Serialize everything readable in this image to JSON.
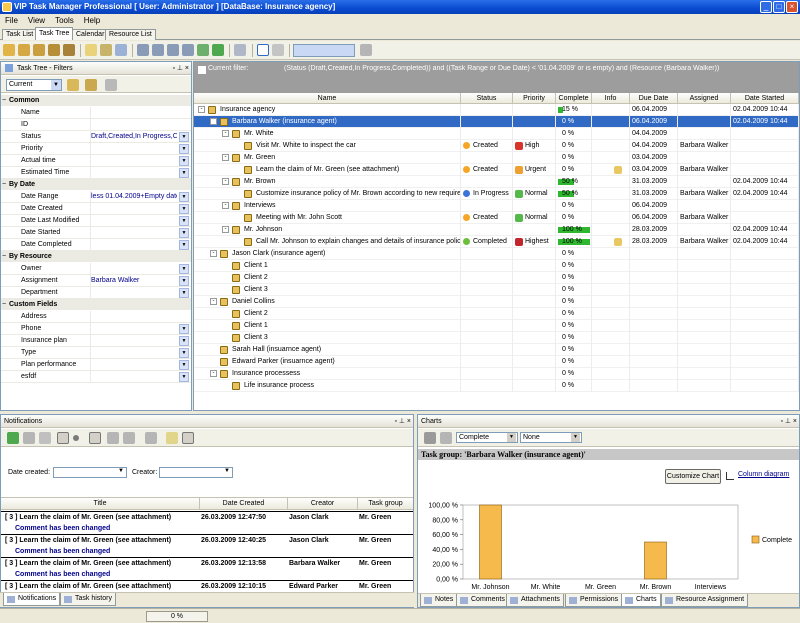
{
  "window": {
    "title": "VIP Task Manager Professional [ User: Administrator ] [DataBase: Insurance agency]"
  },
  "menu": [
    "File",
    "View",
    "Tools",
    "Help"
  ],
  "tabs": [
    "Task List",
    "Task Tree",
    "Calendar",
    "Resource List"
  ],
  "filter_panel": {
    "title": "Task Tree - Filters",
    "current": "Current",
    "categories": [
      {
        "name": "Common",
        "rows": [
          {
            "label": "Name",
            "value": ""
          },
          {
            "label": "ID",
            "value": ""
          },
          {
            "label": "Status",
            "value": "Draft,Created,In Progress,Cor",
            "dd": true
          },
          {
            "label": "Priority",
            "value": "",
            "dd": true
          },
          {
            "label": "Actual time",
            "value": "",
            "dd": true
          },
          {
            "label": "Estimated Time",
            "value": "",
            "dd": true
          }
        ]
      },
      {
        "name": "By Date",
        "rows": [
          {
            "label": "Date Range",
            "value": "less 01.04.2009+Empty date",
            "dd": true
          },
          {
            "label": "Date Created",
            "value": "",
            "dd": true
          },
          {
            "label": "Date Last Modified",
            "value": "",
            "dd": true
          },
          {
            "label": "Date Started",
            "value": "",
            "dd": true
          },
          {
            "label": "Date Completed",
            "value": "",
            "dd": true
          }
        ]
      },
      {
        "name": "By Resource",
        "rows": [
          {
            "label": "Owner",
            "value": "",
            "dd": true
          },
          {
            "label": "Assignment",
            "value": "Barbara Walker",
            "dd": true
          },
          {
            "label": "Department",
            "value": "",
            "dd": true
          }
        ]
      },
      {
        "name": "Custom Fields",
        "rows": [
          {
            "label": "Address",
            "value": ""
          },
          {
            "label": "Phone",
            "value": "",
            "dd": true
          },
          {
            "label": "Insurance plan",
            "value": "",
            "dd": true
          },
          {
            "label": "Type",
            "value": "",
            "dd": true
          },
          {
            "label": "Plan performance",
            "value": "",
            "dd": true
          },
          {
            "label": "esfdf",
            "value": "",
            "dd": true
          }
        ]
      }
    ]
  },
  "current_filter": {
    "label": "Current filter:",
    "expression": "(Status  (Draft,Created,In Progress,Completed)) and ((Task Range or Due Date) < '01.04.2009' or is empty) and (Resource  (Barbara Walker))"
  },
  "tree_columns": [
    "Name",
    "Status",
    "Priority",
    "Complete",
    "Info",
    "Due Date",
    "Assigned",
    "Date Started"
  ],
  "tree_rows": [
    {
      "level": 0,
      "name": "Insurance agency",
      "status": "",
      "priority": "",
      "complete": "15 %",
      "pct": 15,
      "due": "06.04.2009",
      "assigned": "",
      "started": "02.04.2009 10:44",
      "toggle": "-"
    },
    {
      "level": 1,
      "name": "Barbara Walker (insurance agent)",
      "status": "",
      "priority": "",
      "complete": "0 %",
      "pct": 0,
      "due": "06.04.2009",
      "assigned": "",
      "started": "02.04.2009 10:44",
      "selected": true,
      "toggle": "-"
    },
    {
      "level": 2,
      "name": "Mr. White",
      "status": "",
      "priority": "",
      "complete": "0 %",
      "pct": 0,
      "due": "04.04.2009",
      "assigned": "",
      "started": "",
      "toggle": "-"
    },
    {
      "level": 3,
      "name": "Visit Mr. White to inspect the car",
      "status": "Created",
      "priority": "High",
      "complete": "0 %",
      "pct": 0,
      "due": "04.04.2009",
      "assigned": "Barbara Walker",
      "started": ""
    },
    {
      "level": 2,
      "name": "Mr. Green",
      "status": "",
      "priority": "",
      "complete": "0 %",
      "pct": 0,
      "due": "03.04.2009",
      "assigned": "",
      "started": "",
      "toggle": "-"
    },
    {
      "level": 3,
      "name": "Learn the claim of Mr. Green (see attachment)",
      "status": "Created",
      "priority": "Urgent",
      "complete": "0 %",
      "pct": 0,
      "due": "03.04.2009",
      "assigned": "Barbara Walker",
      "started": "",
      "info": true
    },
    {
      "level": 2,
      "name": "Mr. Brown",
      "status": "",
      "priority": "",
      "complete": "50 %",
      "pct": 50,
      "due": "31.03.2009",
      "assigned": "",
      "started": "02.04.2009 10:44",
      "toggle": "-"
    },
    {
      "level": 3,
      "name": "Customize insurance policy of Mr. Brown according to new requirement",
      "status": "In Progress",
      "priority": "Normal",
      "complete": "50 %",
      "pct": 50,
      "due": "31.03.2009",
      "assigned": "Barbara Walker",
      "started": "02.04.2009 10:44"
    },
    {
      "level": 2,
      "name": "Interviews",
      "status": "",
      "priority": "",
      "complete": "0 %",
      "pct": 0,
      "due": "06.04.2009",
      "assigned": "",
      "started": "",
      "toggle": "-"
    },
    {
      "level": 3,
      "name": "Meeting with Mr. John Scott",
      "status": "Created",
      "priority": "Normal",
      "complete": "0 %",
      "pct": 0,
      "due": "06.04.2009",
      "assigned": "Barbara Walker",
      "started": ""
    },
    {
      "level": 2,
      "name": "Mr. Johnson",
      "status": "",
      "priority": "",
      "complete": "100 %",
      "pct": 100,
      "due": "28.03.2009",
      "assigned": "",
      "started": "02.04.2009 10:44",
      "toggle": "-"
    },
    {
      "level": 3,
      "name": "Call Mr. Johnson to explain changes and details of insurance policy",
      "status": "Completed",
      "priority": "Highest",
      "complete": "100 %",
      "pct": 100,
      "due": "28.03.2009",
      "assigned": "Barbara Walker",
      "started": "02.04.2009 10:44",
      "info": true
    },
    {
      "level": 1,
      "name": "Jason Clark (insurance agent)",
      "status": "",
      "priority": "",
      "complete": "0 %",
      "pct": 0,
      "due": "",
      "assigned": "",
      "started": "",
      "toggle": "-"
    },
    {
      "level": 2,
      "name": "Client 1",
      "status": "",
      "priority": "",
      "complete": "0 %",
      "pct": 0,
      "due": "",
      "assigned": "",
      "started": ""
    },
    {
      "level": 2,
      "name": "Client 2",
      "status": "",
      "priority": "",
      "complete": "0 %",
      "pct": 0,
      "due": "",
      "assigned": "",
      "started": ""
    },
    {
      "level": 2,
      "name": "Client 3",
      "status": "",
      "priority": "",
      "complete": "0 %",
      "pct": 0,
      "due": "",
      "assigned": "",
      "started": ""
    },
    {
      "level": 1,
      "name": "Daniel Collins",
      "status": "",
      "priority": "",
      "complete": "0 %",
      "pct": 0,
      "due": "",
      "assigned": "",
      "started": "",
      "toggle": "-"
    },
    {
      "level": 2,
      "name": "Client 2",
      "status": "",
      "priority": "",
      "complete": "0 %",
      "pct": 0,
      "due": "",
      "assigned": "",
      "started": ""
    },
    {
      "level": 2,
      "name": "Client 1",
      "status": "",
      "priority": "",
      "complete": "0 %",
      "pct": 0,
      "due": "",
      "assigned": "",
      "started": ""
    },
    {
      "level": 2,
      "name": "Client 3",
      "status": "",
      "priority": "",
      "complete": "0 %",
      "pct": 0,
      "due": "",
      "assigned": "",
      "started": ""
    },
    {
      "level": 1,
      "name": "Sarah Hall (insuarnce agent)",
      "status": "",
      "priority": "",
      "complete": "0 %",
      "pct": 0,
      "due": "",
      "assigned": "",
      "started": ""
    },
    {
      "level": 1,
      "name": "Edward Parker (insuarnce agent)",
      "status": "",
      "priority": "",
      "complete": "0 %",
      "pct": 0,
      "due": "",
      "assigned": "",
      "started": ""
    },
    {
      "level": 1,
      "name": "Insurance processess",
      "status": "",
      "priority": "",
      "complete": "0 %",
      "pct": 0,
      "due": "",
      "assigned": "",
      "started": "",
      "toggle": "-"
    },
    {
      "level": 2,
      "name": "Life insurance process",
      "status": "",
      "priority": "",
      "complete": "0 %",
      "pct": 0,
      "due": "",
      "assigned": "",
      "started": ""
    }
  ],
  "notifications": {
    "title": "Notifications",
    "date_created_label": "Date created:",
    "creator_label": "Creator:",
    "columns": [
      "Title",
      "Date Created",
      "Creator",
      "Task group"
    ],
    "items": [
      {
        "title": "[ 3 ] Learn the claim of Mr. Green (see attachment)",
        "date": "26.03.2009 12:47:50",
        "creator": "Jason Clark",
        "group": "Mr. Green",
        "comment": "Comment has been changed"
      },
      {
        "title": "[ 3 ] Learn the claim of Mr. Green (see attachment)",
        "date": "26.03.2009 12:40:25",
        "creator": "Jason Clark",
        "group": "Mr. Green",
        "comment": "Comment has been changed"
      },
      {
        "title": "[ 3 ] Learn the claim of Mr. Green (see attachment)",
        "date": "26.03.2009 12:13:58",
        "creator": "Barbara Walker",
        "group": "Mr. Green",
        "comment": "Comment has been changed"
      },
      {
        "title": "[ 3 ] Learn the claim of Mr. Green (see attachment)",
        "date": "26.03.2009 12:10:15",
        "creator": "Edward Parker",
        "group": "Mr. Green",
        "comment": "Comment has been changed"
      }
    ],
    "tabs": [
      "Notifications",
      "Task history"
    ]
  },
  "charts": {
    "title": "Charts",
    "mode": "Complete",
    "group_by": "None",
    "task_group": "Task group: 'Barbara Walker (insurance agent)'",
    "customize_label": "Customize Chart",
    "column_diagram_label": "Column diagram",
    "tabs": [
      "Notes",
      "Comments",
      "Attachments",
      "Permissions",
      "Charts",
      "Resource Assignment"
    ]
  },
  "chart_data": {
    "type": "bar",
    "categories": [
      "Mr. Johnson",
      "Mr. White",
      "Mr. Green",
      "Mr. Brown",
      "Interviews"
    ],
    "series": [
      {
        "name": "Complete",
        "values": [
          100,
          0,
          0,
          50,
          0
        ]
      }
    ],
    "ylim": [
      0,
      100
    ],
    "yticks": [
      "0,00 %",
      "20,00 %",
      "40,00 %",
      "60,00 %",
      "80,00 %",
      "100,00 %"
    ],
    "legend": "right",
    "color": "#f5b94c"
  },
  "status": {
    "progress_text": "0 %"
  },
  "colors": {
    "selected_row": "#316ac5",
    "progress": "#2fb82f",
    "bar": "#f5b94c"
  }
}
